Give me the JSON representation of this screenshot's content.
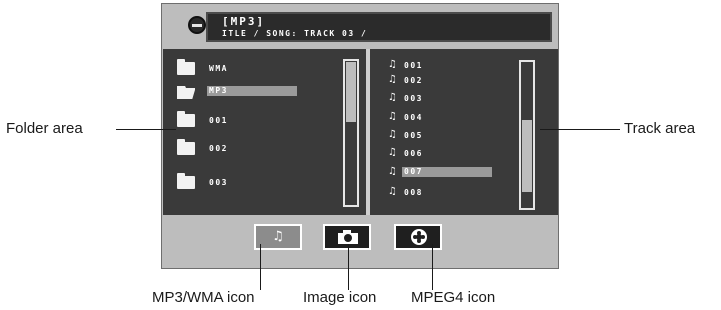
{
  "header": {
    "title": "[MP3]",
    "subtitle": "ITLE / SONG: TRACK 03 /"
  },
  "folders": [
    {
      "label": "WMA",
      "icon": "folder-icon",
      "selected": false
    },
    {
      "label": "MP3",
      "icon": "folder-open-icon",
      "selected": true
    },
    {
      "label": "001",
      "icon": "folder-icon",
      "selected": false
    },
    {
      "label": "002",
      "icon": "folder-icon",
      "selected": false
    },
    {
      "label": "003",
      "icon": "folder-icon",
      "selected": false
    }
  ],
  "tracks": [
    {
      "label": "001",
      "selected": false
    },
    {
      "label": "002",
      "selected": false
    },
    {
      "label": "003",
      "selected": false
    },
    {
      "label": "004",
      "selected": false
    },
    {
      "label": "005",
      "selected": false
    },
    {
      "label": "006",
      "selected": false
    },
    {
      "label": "007",
      "selected": true
    },
    {
      "label": "008",
      "selected": false
    }
  ],
  "media_buttons": [
    {
      "name": "mp3-wma-button",
      "icon": "music-note-icon",
      "active": true
    },
    {
      "name": "image-button",
      "icon": "camera-icon",
      "active": false
    },
    {
      "name": "mpeg4-button",
      "icon": "film-reel-icon",
      "active": false
    }
  ],
  "callouts": {
    "folder_area": "Folder area",
    "track_area": "Track area",
    "mp3_wma_icon": "MP3/WMA icon",
    "image_icon": "Image icon",
    "mpeg4_icon": "MPEG4 icon"
  },
  "colors": {
    "panel_bg": "#3a3a3a",
    "frame_bg": "#bdbdbd",
    "highlight": "#9a9a9a"
  }
}
